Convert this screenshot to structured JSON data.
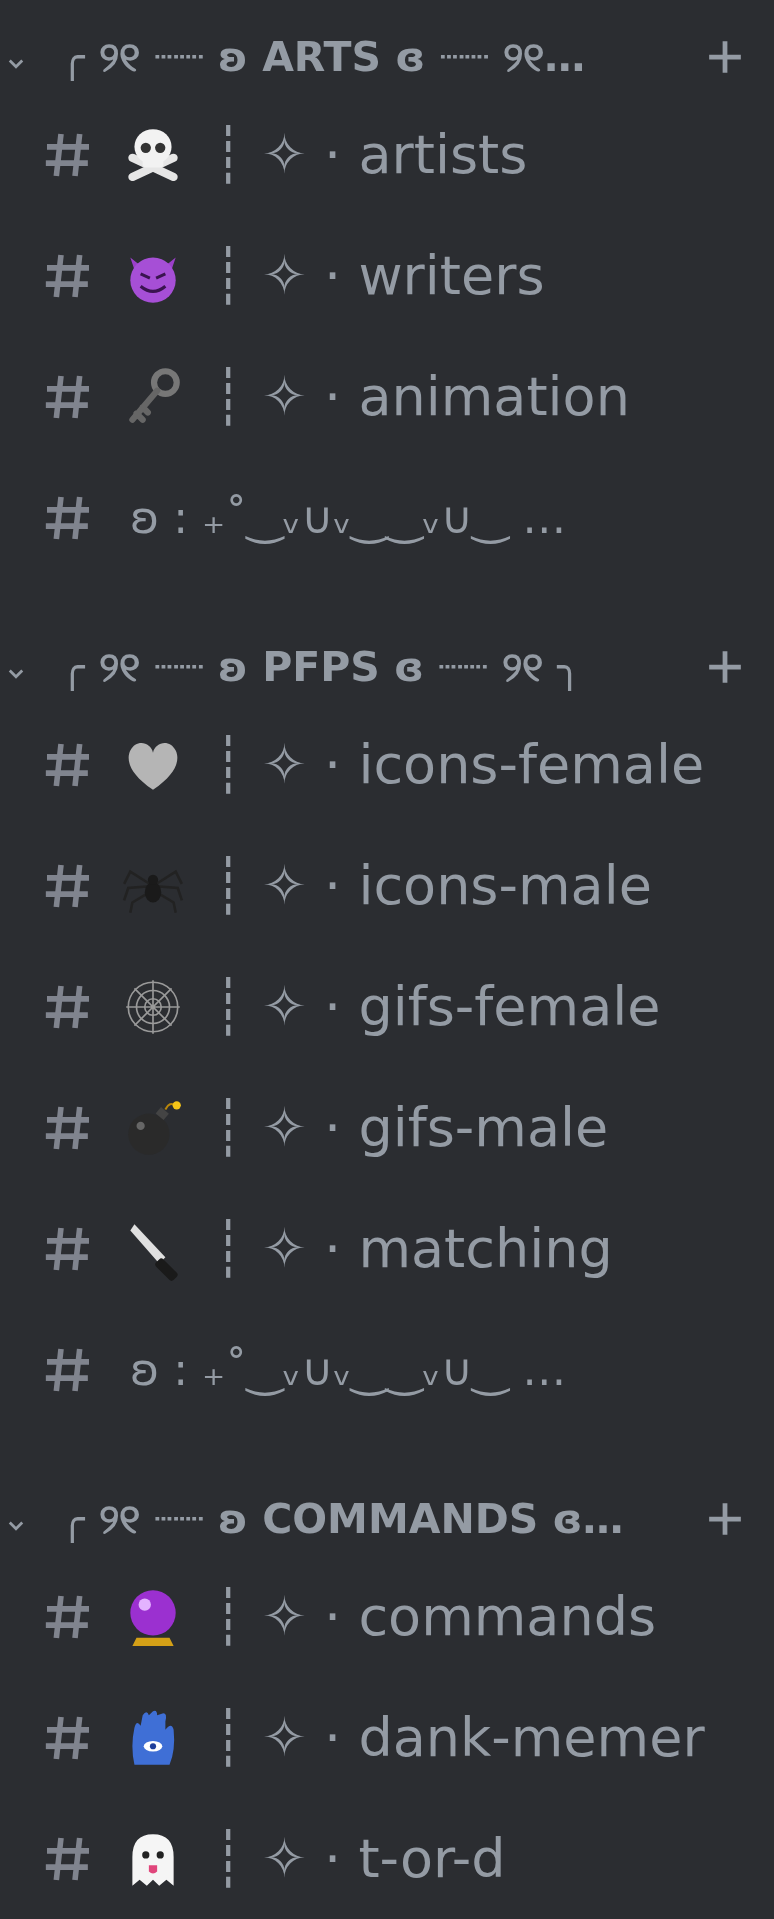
{
  "categories": [
    {
      "title": "╭ ୨୧ ┈┈ ʚ ARTS ɞ ┈┈ ୨୧…",
      "expanded": true,
      "channels": [
        {
          "kind": "text",
          "name": "┊ ✧ · artists"
        },
        {
          "kind": "text",
          "name": "┊ ✧ · writers"
        },
        {
          "kind": "text",
          "name": "┊ ✧ · animation"
        },
        {
          "kind": "separator",
          "name": "ʚ ꞉ ₊˚‿ᵥ∪ᵥ‿‿ᵥ∪‿ …"
        }
      ]
    },
    {
      "title": "╭ ୨୧ ┈┈ ʚ PFPS ɞ ┈┈ ୨୧ ╮",
      "expanded": true,
      "channels": [
        {
          "kind": "text",
          "name": "┊ ✧ · icons-female"
        },
        {
          "kind": "text",
          "name": "┊ ✧ · icons-male"
        },
        {
          "kind": "text",
          "name": "┊ ✧ · gifs-female"
        },
        {
          "kind": "text",
          "name": "┊ ✧ · gifs-male"
        },
        {
          "kind": "text",
          "name": "┊ ✧ · matching"
        },
        {
          "kind": "separator",
          "name": "ʚ ꞉ ₊˚‿ᵥ∪ᵥ‿‿ᵥ∪‿ …"
        }
      ]
    },
    {
      "title": "╭ ୨୧ ┈┈ ʚ COMMANDS ɞ…",
      "expanded": true,
      "channels": [
        {
          "kind": "text",
          "name": "┊ ✧ · commands"
        },
        {
          "kind": "text",
          "name": "┊ ✧ · dank-memer"
        },
        {
          "kind": "text",
          "name": "┊ ✧ · t-or-d"
        }
      ]
    }
  ]
}
